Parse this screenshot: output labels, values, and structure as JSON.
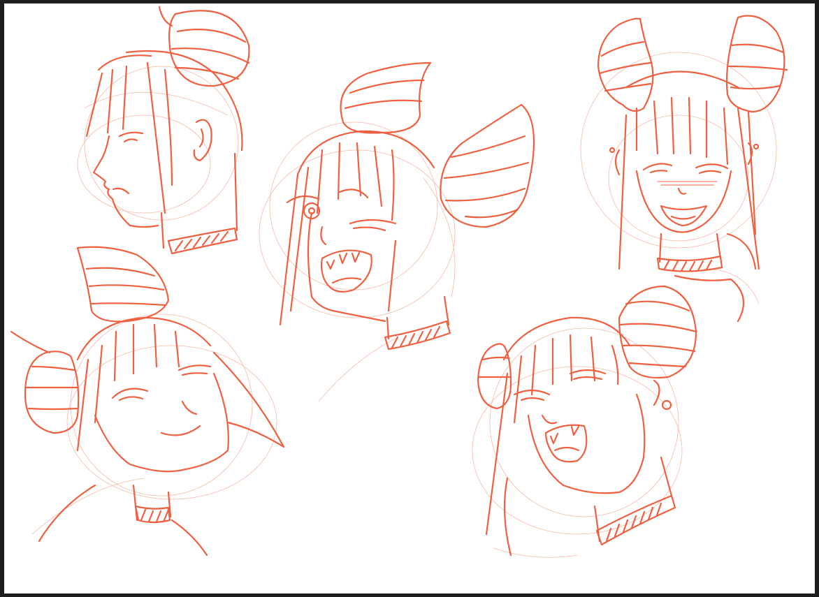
{
  "canvas": {
    "background": "#ffffff",
    "frame_color": "#1e1e1e",
    "line_color": "#f06040",
    "sketch_color": "#f7b9a8"
  },
  "sketches": [
    {
      "name": "head-profile-left",
      "expression": "grimace"
    },
    {
      "name": "head-shouting-center",
      "expression": "shouting"
    },
    {
      "name": "head-grinning-top-right",
      "expression": "tongue-out-grin"
    },
    {
      "name": "head-smirk-bottom-left",
      "expression": "smirk"
    },
    {
      "name": "head-laughing-bottom-right",
      "expression": "laughing"
    }
  ]
}
